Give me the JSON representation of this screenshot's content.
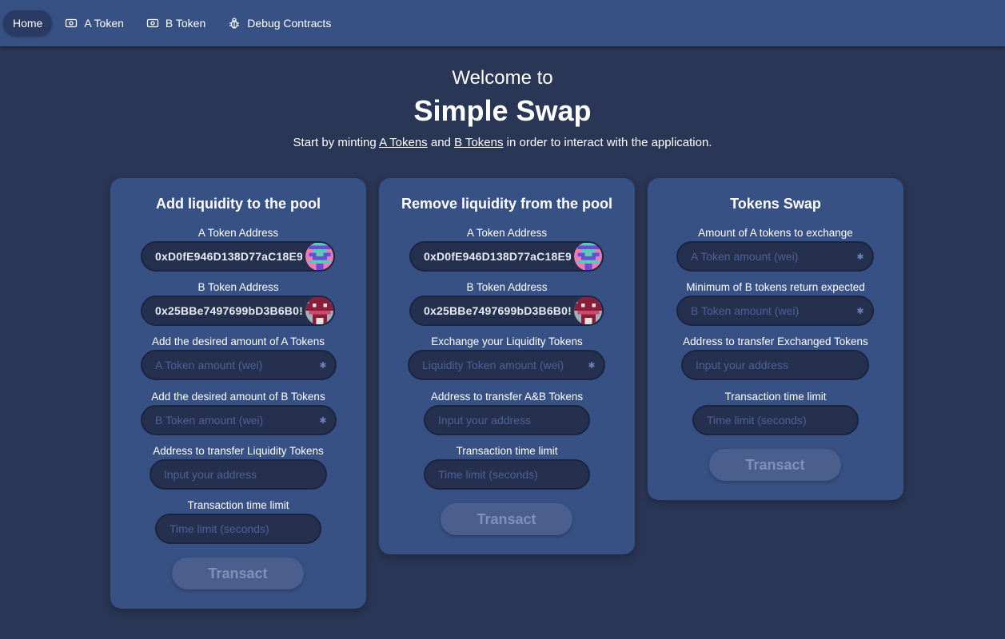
{
  "nav": {
    "items": [
      {
        "label": "Home",
        "icon": "home"
      },
      {
        "label": "A Token",
        "icon": "banknote-icon"
      },
      {
        "label": "B Token",
        "icon": "banknote-icon"
      },
      {
        "label": "Debug Contracts",
        "icon": "bug-icon"
      }
    ]
  },
  "hero": {
    "welcome": "Welcome to",
    "title": "Simple Swap",
    "subtitle_prefix": "Start by minting ",
    "link_a": "A Tokens",
    "subtitle_mid": " and ",
    "link_b": "B Tokens",
    "subtitle_suffix": " in order to interact with the application."
  },
  "add_liquidity": {
    "title": "Add liquidity to the pool",
    "a_address_label": "A Token Address",
    "a_address_value": "0xD0fE946D138D77aC18E9",
    "b_address_label": "B Token Address",
    "b_address_value": "0x25BBe7497699bD3B6B0!",
    "a_amount_label": "Add the desired amount of A Tokens",
    "a_amount_placeholder": "A Token amount (wei)",
    "b_amount_label": "Add the desired amount of B Tokens",
    "b_amount_placeholder": "B Token amount (wei)",
    "to_label": "Address to transfer Liquidity Tokens",
    "to_placeholder": "Input your address",
    "deadline_label": "Transaction time limit",
    "deadline_placeholder": "Time limit (seconds)",
    "button": "Transact"
  },
  "remove_liquidity": {
    "title": "Remove liquidity from the pool",
    "a_address_label": "A Token Address",
    "a_address_value": "0xD0fE946D138D77aC18E9",
    "b_address_label": "B Token Address",
    "b_address_value": "0x25BBe7497699bD3B6B0!",
    "liq_label": "Exchange your Liquidity Tokens",
    "liq_placeholder": "Liquidity Token amount (wei)",
    "to_label": "Address to transfer A&B Tokens",
    "to_placeholder": "Input your address",
    "deadline_label": "Transaction time limit",
    "deadline_placeholder": "Time limit (seconds)",
    "button": "Transact"
  },
  "swap": {
    "title": "Tokens Swap",
    "a_amount_label": "Amount of A tokens to exchange",
    "a_amount_placeholder": "A Token amount (wei)",
    "b_min_label": "Minimum of B tokens return expected",
    "b_min_placeholder": "B Token amount (wei)",
    "to_label": "Address to transfer Exchanged Tokens",
    "to_placeholder": "Input your address",
    "deadline_label": "Transaction time limit",
    "deadline_placeholder": "Time limit (seconds)",
    "button": "Transact"
  },
  "colors": {
    "background": "#2a3655",
    "navbar": "#385185",
    "card": "#385185",
    "input_bg": "#25304f",
    "button_disabled": "#4b5f8f"
  }
}
